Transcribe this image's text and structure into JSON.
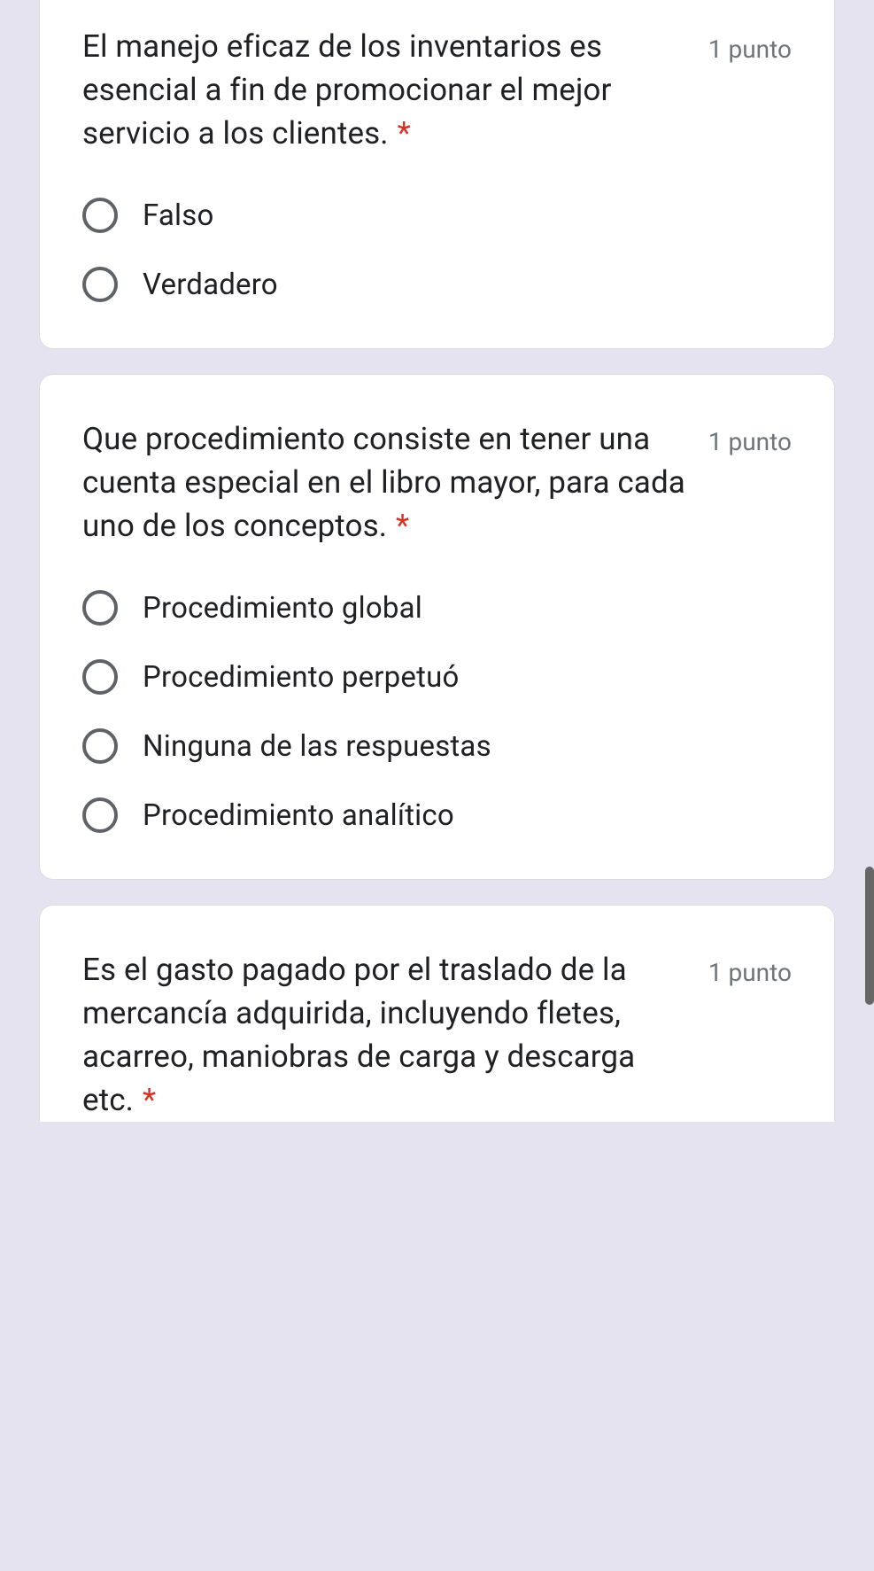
{
  "points_label": "1 punto",
  "required_mark": "*",
  "questions": [
    {
      "text": "El manejo eficaz de los inventarios es esencial a fin de promocionar el mejor servicio a los clientes.",
      "options": [
        "Falso",
        "Verdadero"
      ]
    },
    {
      "text": "Que procedimiento consiste en tener una cuenta especial en el libro mayor, para cada uno de los conceptos.",
      "options": [
        "Procedimiento global",
        "Procedimiento perpetuó",
        "Ninguna de las respuestas",
        "Procedimiento analítico"
      ]
    },
    {
      "text": "Es el gasto pagado por el traslado de la mercancía adquirida, incluyendo fletes, acarreo, maniobras de carga y descarga etc.",
      "options": []
    }
  ]
}
